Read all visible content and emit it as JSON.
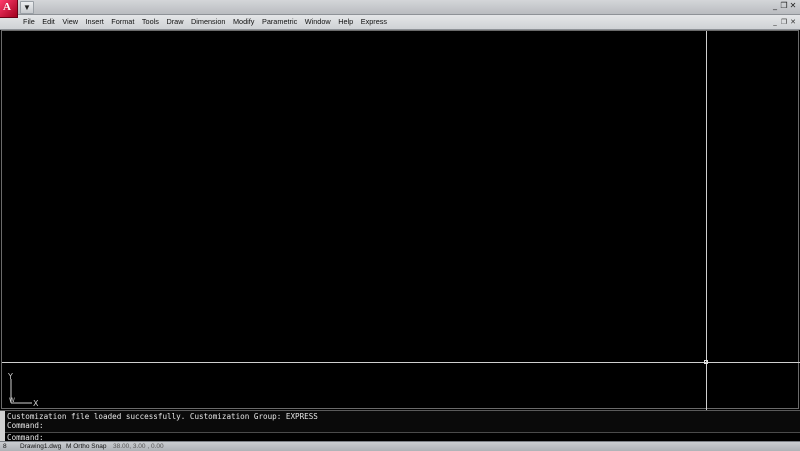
{
  "titlebar": {
    "app_icon": "autocad-app-icon",
    "quick_access_glyph": "▼",
    "window_controls": [
      "_",
      "❐",
      "✕"
    ]
  },
  "menubar": {
    "items": [
      "File",
      "Edit",
      "View",
      "Insert",
      "Format",
      "Tools",
      "Draw",
      "Dimension",
      "Modify",
      "Parametric",
      "Window",
      "Help",
      "Express"
    ],
    "doc_controls": [
      "_",
      "❐",
      "✕"
    ]
  },
  "canvas": {
    "background": "#000000",
    "ucs": {
      "y_label": "Y",
      "x_label": "X",
      "origin_label": "W"
    }
  },
  "command": {
    "history": "Customization file loaded successfully. Customization Group: EXPRESS",
    "prev_prompt": "Command:",
    "prompt": "Command:"
  },
  "statusbar": {
    "drawing": "Drawing1.dwg",
    "modes": "M Ortho Snap",
    "coordinates": "38.00, 3.00 , 0.00",
    "left_glyph": "8"
  }
}
